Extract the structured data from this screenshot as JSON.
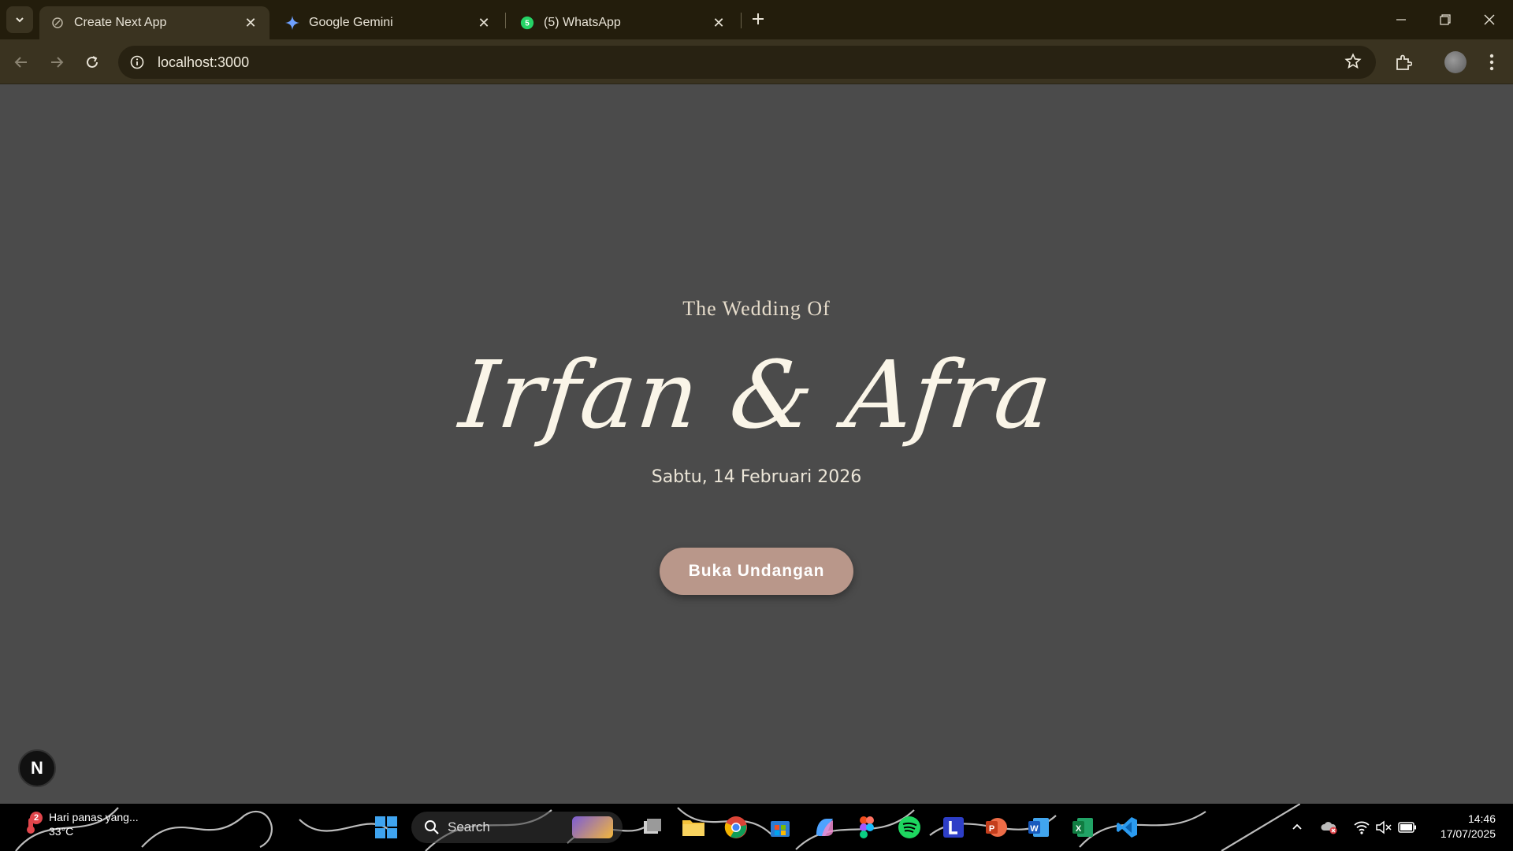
{
  "browser": {
    "tabs": [
      {
        "title": "Create Next App",
        "favicon": "next-favicon-icon",
        "active": true
      },
      {
        "title": "Google Gemini",
        "favicon": "gemini-icon",
        "active": false
      },
      {
        "title": "(5) WhatsApp",
        "favicon": "whatsapp-icon",
        "active": false
      }
    ],
    "url": "localhost:3000",
    "theme_color": "#3a3320"
  },
  "invitation": {
    "subtitle": "The Wedding Of",
    "names": "Irfan & Afra",
    "date": "Sabtu, 14 Februari 2026",
    "button_label": "Buka Undangan",
    "button_color": "#b9978a",
    "background": "#4b4b4b"
  },
  "next_badge": "N",
  "taskbar": {
    "weather_badge": "2",
    "weather_text": "Hari panas yang...",
    "temperature": "33°C",
    "search_label": "Search",
    "time": "14:46",
    "date": "17/07/2025"
  }
}
